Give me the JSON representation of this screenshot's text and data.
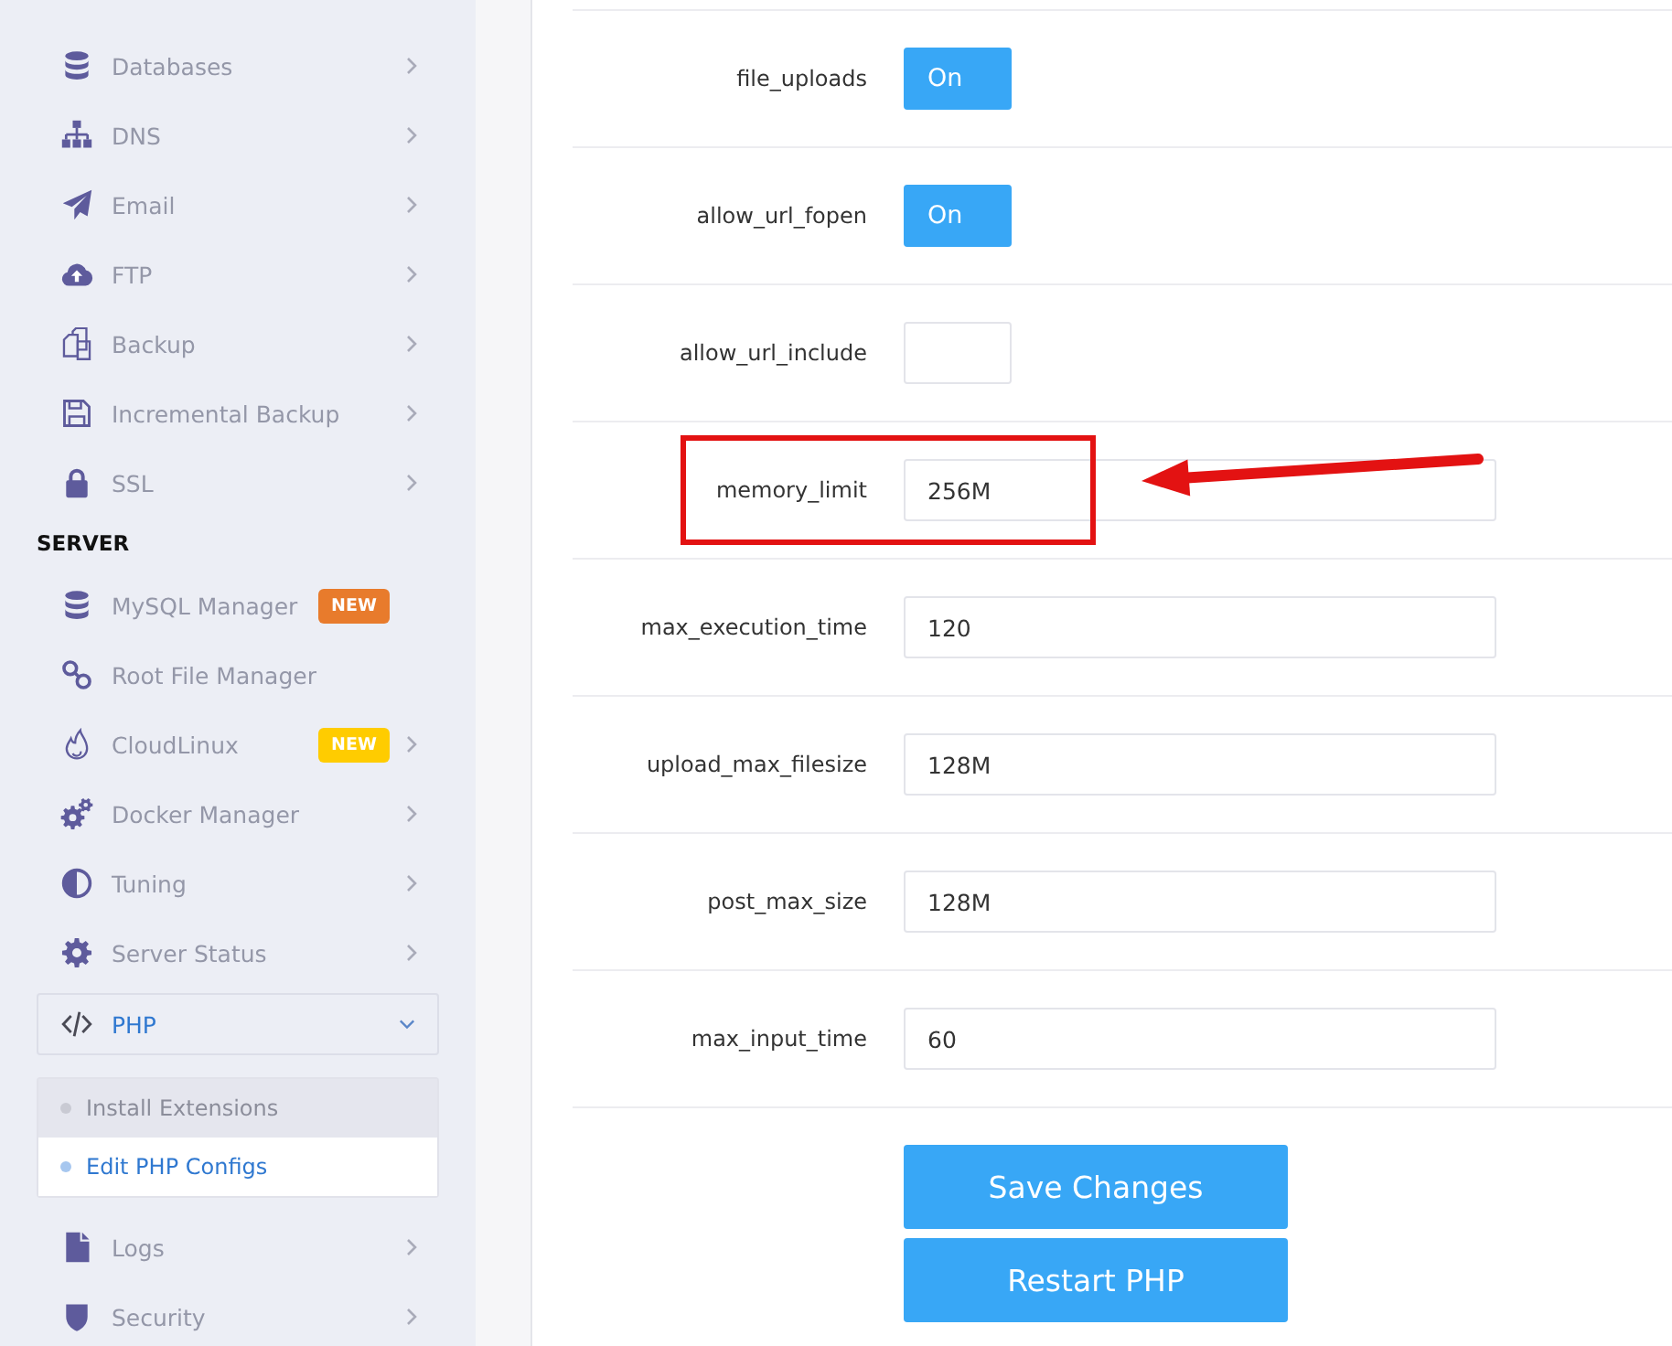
{
  "sidebar": {
    "sections": [
      {
        "items": [
          {
            "label": "Databases",
            "expanded": false
          },
          {
            "label": "DNS",
            "expanded": false
          },
          {
            "label": "Email",
            "expanded": false
          },
          {
            "label": "FTP",
            "expanded": false
          },
          {
            "label": "Backup",
            "expanded": false
          },
          {
            "label": "Incremental Backup",
            "expanded": false
          },
          {
            "label": "SSL",
            "expanded": false
          }
        ]
      },
      {
        "heading": "SERVER",
        "items": [
          {
            "label": "MySQL Manager",
            "badge": {
              "text": "NEW",
              "color": "#e87b2c"
            }
          },
          {
            "label": "Root File Manager"
          },
          {
            "label": "CloudLinux",
            "badge": {
              "text": "NEW",
              "color": "#ffcc00"
            },
            "expanded": false
          },
          {
            "label": "Docker Manager",
            "expanded": false
          },
          {
            "label": "Tuning",
            "expanded": false
          },
          {
            "label": "Server Status",
            "expanded": false
          },
          {
            "label": "PHP",
            "expanded": true,
            "children": [
              {
                "label": "Install Extensions",
                "selected": false
              },
              {
                "label": "Edit PHP Configs",
                "selected": true
              }
            ]
          },
          {
            "label": "Logs",
            "expanded": false
          },
          {
            "label": "Security",
            "expanded": false
          }
        ]
      }
    ]
  },
  "settings": [
    {
      "name": "file_uploads",
      "kind": "toggle",
      "on": true,
      "text": "On",
      "highlighted": false
    },
    {
      "name": "allow_url_fopen",
      "kind": "toggle",
      "on": true,
      "text": "On",
      "highlighted": false
    },
    {
      "name": "allow_url_include",
      "kind": "toggle",
      "on": false,
      "highlighted": false
    },
    {
      "name": "memory_limit",
      "kind": "text",
      "value": "256M",
      "highlighted": true
    },
    {
      "name": "max_execution_time",
      "kind": "text",
      "value": "120",
      "highlighted": false
    },
    {
      "name": "upload_max_filesize",
      "kind": "text",
      "value": "128M",
      "highlighted": false
    },
    {
      "name": "post_max_size",
      "kind": "text",
      "value": "128M",
      "highlighted": false
    },
    {
      "name": "max_input_time",
      "kind": "text",
      "value": "60",
      "highlighted": false
    }
  ],
  "buttons": [
    "Save Changes",
    "Restart PHP"
  ]
}
